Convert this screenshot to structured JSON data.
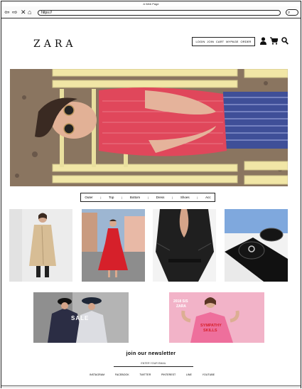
{
  "window": {
    "title": "A Web Page"
  },
  "browser": {
    "url": "https://",
    "back_icon": "back-arrow-icon",
    "forward_icon": "forward-arrow-icon",
    "close_icon": "close-x-icon",
    "home_icon": "home-icon",
    "search_icon": "search-icon"
  },
  "header": {
    "logo": "ZARA",
    "nav": [
      "LOGIN",
      "JOIN",
      "CART",
      "MYPAGE",
      "ORDER"
    ],
    "icons": [
      "user-icon",
      "cart-icon",
      "search-icon"
    ]
  },
  "categories": [
    "Outer",
    "Top",
    "Bottom",
    "Dress",
    "Shoes",
    "Acc"
  ],
  "banners": {
    "sale": {
      "text": "SALE"
    },
    "ss": {
      "line1": "2018 S/S",
      "line2": "ZARA",
      "shirt_line1": "SYMPATHY",
      "shirt_line2": "SKILLS"
    }
  },
  "newsletter": {
    "title": "join our newsletter",
    "placeholder": "ENTER YOUR EMAIL",
    "social": [
      "INSTAGRAM",
      "FACEBOOK",
      "TWITTER",
      "PINTEREST",
      "LINE",
      "YOUTUBE"
    ]
  },
  "colors": {
    "accent": "#111111",
    "hero_shirt": "#e0475b",
    "dress": "#d6202a",
    "banner_pink": "#f2b3c8"
  }
}
